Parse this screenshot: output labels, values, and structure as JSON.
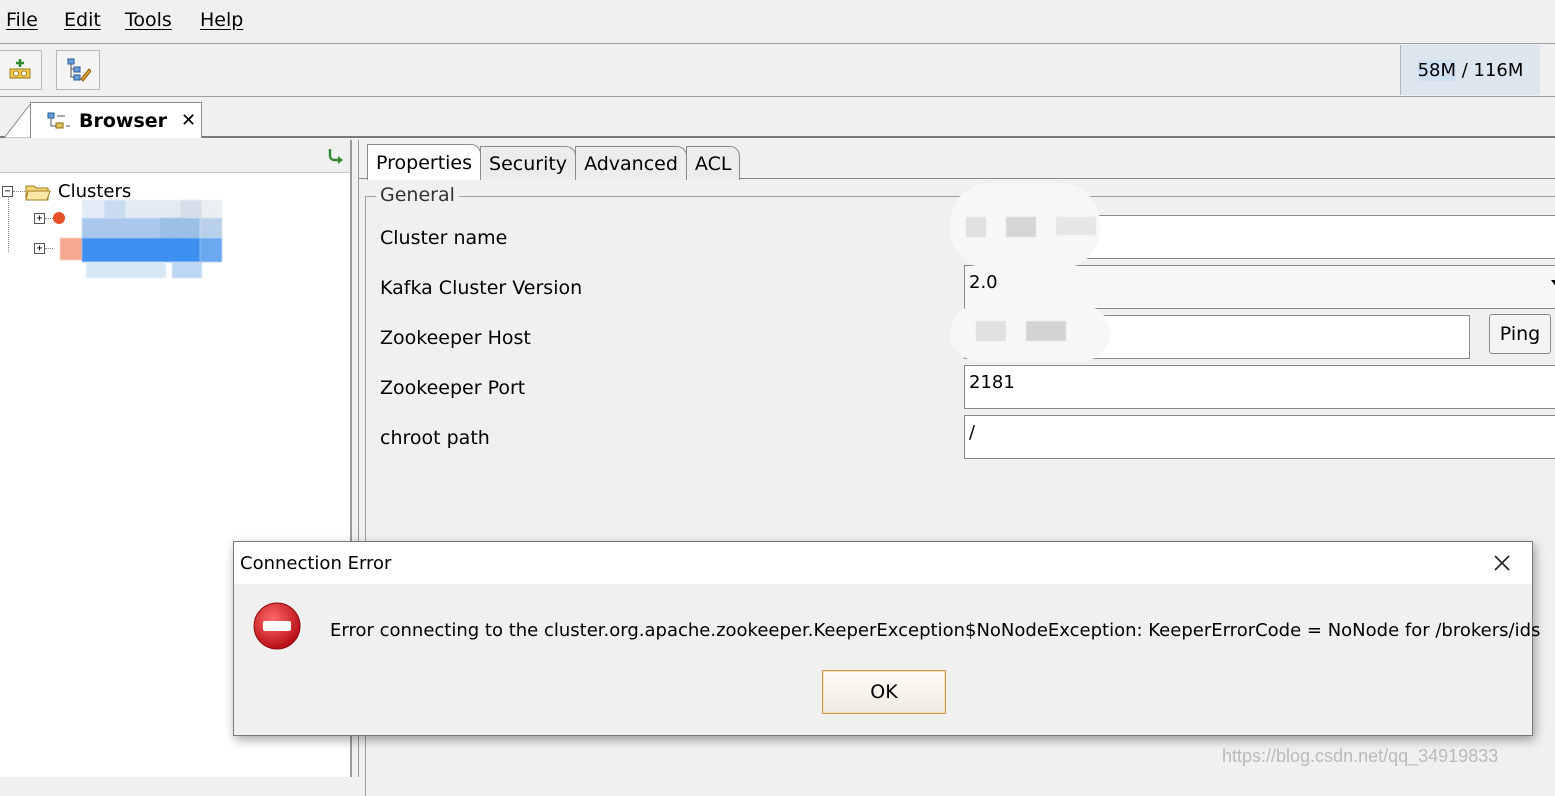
{
  "menu": {
    "file": "File",
    "edit": "Edit",
    "tools": "Tools",
    "help": "Help"
  },
  "toolbar": {
    "memory_used": "58M",
    "memory_sep": " / ",
    "memory_total": "116M",
    "icons": [
      "add-cluster-icon",
      "cluster-tree-edit-icon"
    ]
  },
  "tabstrip": {
    "browser_tab_label": "Browser",
    "close_glyph": "✕"
  },
  "tree": {
    "root_label": "Clusters",
    "root_expander": "−",
    "child_expander": "+"
  },
  "properties": {
    "tabs": [
      "Properties",
      "Security",
      "Advanced",
      "ACL"
    ],
    "active_tab": "Properties",
    "group_title": "General",
    "fields": {
      "cluster_name_label": "Cluster name",
      "cluster_name_value": "",
      "kafka_version_label": "Kafka Cluster Version",
      "kafka_version_value": "2.0",
      "zk_host_label": "Zookeeper Host",
      "zk_host_value": "",
      "zk_port_label": "Zookeeper Port",
      "zk_port_value": "2181",
      "chroot_label": "chroot path",
      "chroot_value": "/"
    },
    "ping_label": "Ping"
  },
  "dialog": {
    "title": "Connection Error",
    "message": "Error connecting to the cluster.org.apache.zookeeper.KeeperException$NoNodeException: KeeperErrorCode = NoNode for /brokers/ids",
    "ok_label": "OK",
    "close_glyph": "✕"
  },
  "watermark": "https://blog.csdn.net/qq_34919833",
  "colors": {
    "accent_blue": "#3d8ff0",
    "error_red": "#d9262b",
    "ok_border": "#c69a48"
  }
}
